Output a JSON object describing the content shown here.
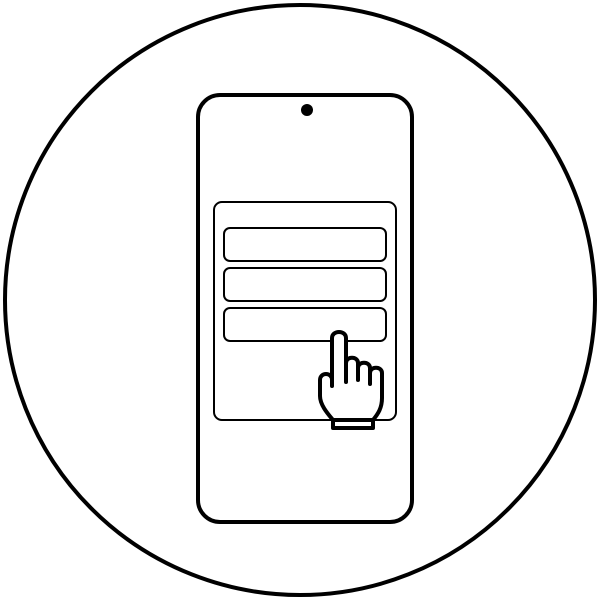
{
  "illustration": {
    "subject": "smartphone-form-tap-icon",
    "colors": {
      "stroke": "#000000",
      "background": "#ffffff",
      "fill": "#ffffff"
    },
    "form": {
      "field_count": 3
    }
  }
}
